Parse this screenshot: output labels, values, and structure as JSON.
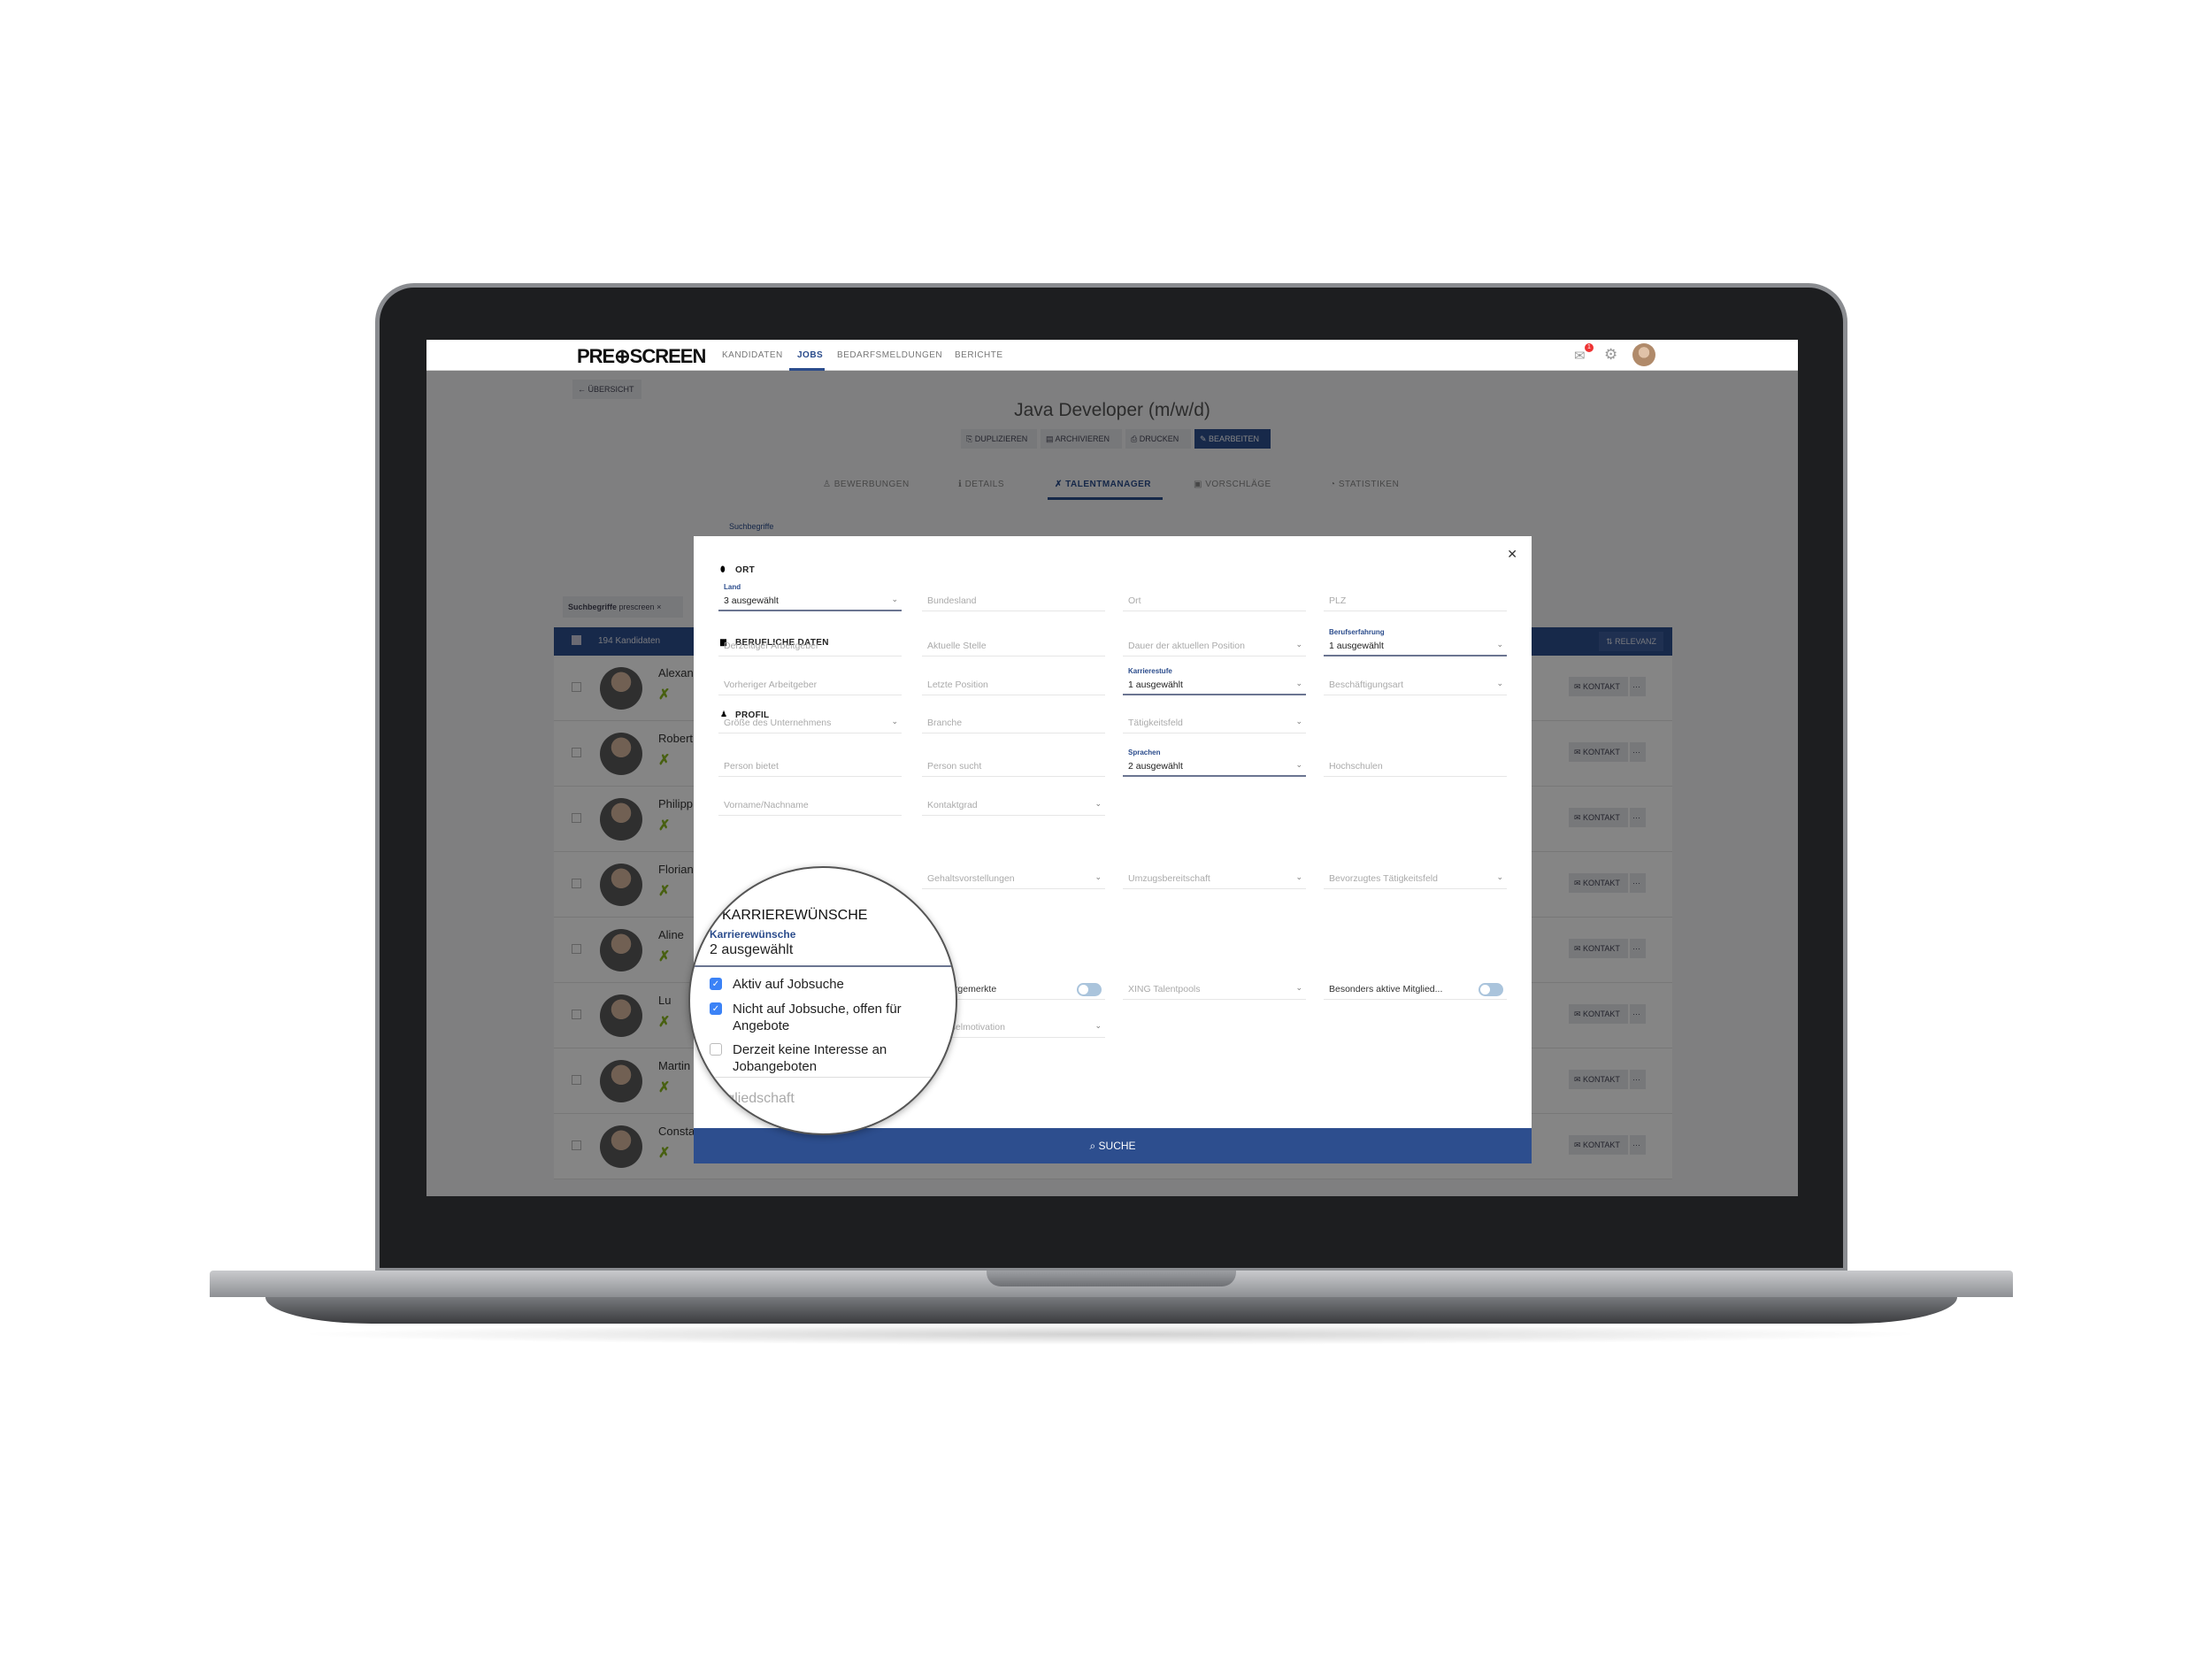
{
  "header": {
    "logo": "PRE⊕SCREEN",
    "nav": [
      {
        "label": "KANDIDATEN",
        "active": false
      },
      {
        "label": "JOBS",
        "active": true
      },
      {
        "label": "BEDARFSMELDUNGEN",
        "active": false
      },
      {
        "label": "BERICHTE",
        "active": false
      }
    ],
    "notification_count": "1",
    "icons": [
      "mail-icon",
      "gear-icon",
      "avatar"
    ]
  },
  "page": {
    "back_label": "← ÜBERSICHT",
    "title": "Java Developer (m/w/d)",
    "actions": [
      {
        "label": "⎘ DUPLIZIEREN",
        "primary": false
      },
      {
        "label": "▤ ARCHIVIEREN",
        "primary": false
      },
      {
        "label": "⎙ DRUCKEN",
        "primary": false
      },
      {
        "label": "✎ BEARBEITEN",
        "primary": true
      }
    ],
    "tabs": [
      {
        "label": "♙ BEWERBUNGEN",
        "active": false
      },
      {
        "label": "ℹ DETAILS",
        "active": false
      },
      {
        "label": "✗ TALENTMANAGER",
        "active": true
      },
      {
        "label": "▣ VORSCHLÄGE",
        "active": false
      },
      {
        "label": "◔ STATISTIKEN",
        "active": false
      }
    ],
    "search_label": "Suchbegriffe",
    "chip": {
      "key": "Suchbegriffe",
      "value": "prescreen"
    },
    "list": {
      "count": "194 Kandidaten",
      "sort": "⇅ RELEVANZ",
      "contact": "✉ KONTAKT",
      "more": "···",
      "candidates": [
        "Alexan",
        "Robert",
        "Philipp",
        "Florian",
        "Aline",
        "Lu",
        "Martin",
        "Consta"
      ]
    }
  },
  "modal": {
    "close": "✕",
    "sections": [
      {
        "title": "ORT",
        "icon": "map-pin-icon",
        "glyph": "⬮"
      },
      {
        "title": "BERUFLICHE DATEN",
        "icon": "briefcase-icon",
        "glyph": "▆"
      },
      {
        "title": "PROFIL",
        "icon": "user-icon",
        "glyph": "♟"
      }
    ],
    "fields": [
      {
        "label": "Land",
        "value": "3 ausgewählt",
        "select": true,
        "sel": true
      },
      {
        "value": "Bundesland"
      },
      {
        "value": "Ort"
      },
      {
        "value": "PLZ"
      },
      {
        "value": "Derzeitiger Arbeitgeber"
      },
      {
        "value": "Aktuelle Stelle"
      },
      {
        "value": "Dauer der aktuellen Position",
        "select": true
      },
      {
        "label": "Berufserfahrung",
        "value": "1 ausgewählt",
        "select": true,
        "sel": true
      },
      {
        "value": "Vorheriger Arbeitgeber"
      },
      {
        "value": "Letzte Position"
      },
      {
        "label": "Karrierestufe",
        "value": "1 ausgewählt",
        "select": true,
        "sel": true
      },
      {
        "value": "Beschäftigungsart",
        "select": true
      },
      {
        "value": "Größe des Unternehmens",
        "select": true
      },
      {
        "value": "Branche"
      },
      {
        "value": "Tätigkeitsfeld",
        "select": true
      },
      {
        "value": "Person bietet"
      },
      {
        "value": "Person sucht"
      },
      {
        "label": "Sprachen",
        "value": "2 ausgewählt",
        "select": true,
        "sel": true
      },
      {
        "value": "Hochschulen"
      },
      {
        "value": "Vorname/Nachname"
      },
      {
        "value": "Kontaktgrad",
        "select": true
      },
      {
        "value": "Gehaltsvorstellungen",
        "select": true
      },
      {
        "value": "Umzugsbereitschaft",
        "select": true
      },
      {
        "value": "Bevorzugtes Tätigkeitsfeld",
        "select": true
      },
      {
        "value": "Nur vorgemerkte",
        "toggle": true,
        "on": false
      },
      {
        "value": "XING Talentpools",
        "select": true
      },
      {
        "value": "Besonders aktive Mitglied...",
        "toggle": true,
        "on": false
      },
      {
        "value": "Wechselmotivation",
        "select": true
      }
    ],
    "submit": "⌕ SUCHE",
    "magnifier": {
      "section": "KARRIEREWÜNSCHE",
      "label": "Karrierewünsche",
      "value": "2 ausgewählt",
      "options": [
        {
          "label": "Aktiv auf Jobsuche",
          "checked": true
        },
        {
          "label": "Nicht auf Jobsuche, offen für Angebote",
          "checked": true
        },
        {
          "label": "Derzeit keine Interesse an Jobangeboten",
          "checked": false
        }
      ],
      "next_field": "Mitgliedschaft"
    }
  },
  "colors": {
    "primary": "#2d4e8e",
    "checkbox": "#3b82f6",
    "toggle": "#aac4dc"
  }
}
